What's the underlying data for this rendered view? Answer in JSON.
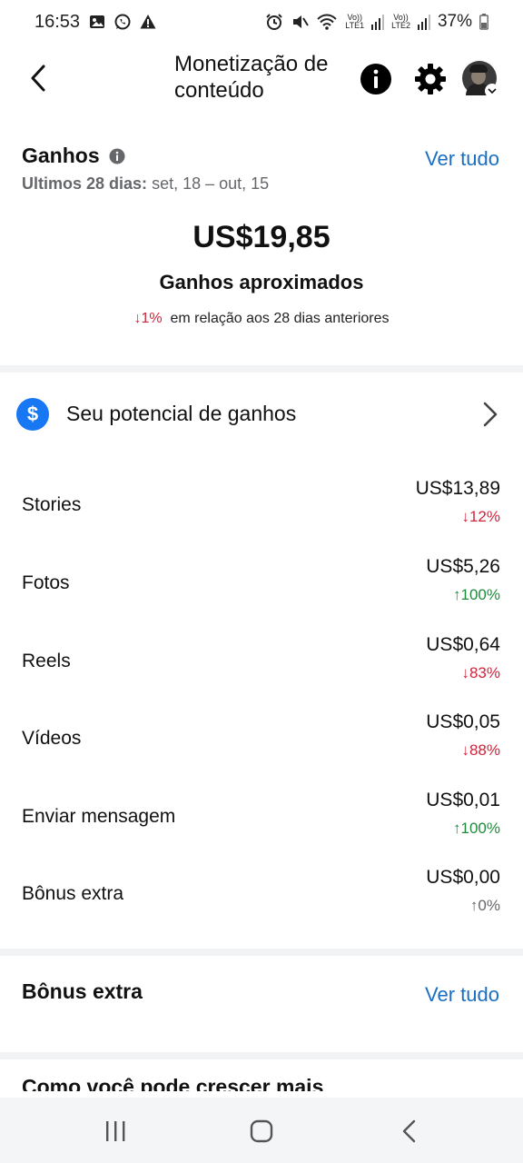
{
  "status_bar": {
    "time": "16:53",
    "battery": "37%",
    "sim1": "LTE1",
    "sim2": "LTE2",
    "volte": "Vo))"
  },
  "header": {
    "title": "Monetização de conteúdo"
  },
  "earnings": {
    "title": "Ganhos",
    "see_all": "Ver tudo",
    "period_label": "Ultimos 28 dias:",
    "period_range": "set, 18 – out, 15",
    "amount": "US$19,85",
    "amount_label": "Ganhos aproximados",
    "change": "↓1%",
    "change_text": "em relação aos 28 dias anteriores"
  },
  "potential": {
    "label": "Seu potencial de ganhos",
    "icon_glyph": "$"
  },
  "breakdown": [
    {
      "label": "Stories",
      "amount": "US$13,89",
      "change": "↓12%",
      "trend": "down"
    },
    {
      "label": "Fotos",
      "amount": "US$5,26",
      "change": "↑100%",
      "trend": "up"
    },
    {
      "label": "Reels",
      "amount": "US$0,64",
      "change": "↓83%",
      "trend": "down"
    },
    {
      "label": "Vídeos",
      "amount": "US$0,05",
      "change": "↓88%",
      "trend": "down"
    },
    {
      "label": "Enviar mensagem",
      "amount": "US$0,01",
      "change": "↑100%",
      "trend": "up"
    },
    {
      "label": "Bônus extra",
      "amount": "US$0,00",
      "change": "↑0%",
      "trend": "neutral"
    }
  ],
  "bonus": {
    "title": "Bônus extra",
    "see_all": "Ver tudo"
  },
  "next_section_peek": "Como você pode crescer mais",
  "colors": {
    "link": "#1a6fc4",
    "accent": "#1877f2",
    "down": "#d0233a",
    "up": "#1e8b3c",
    "neutral": "#65676b"
  }
}
